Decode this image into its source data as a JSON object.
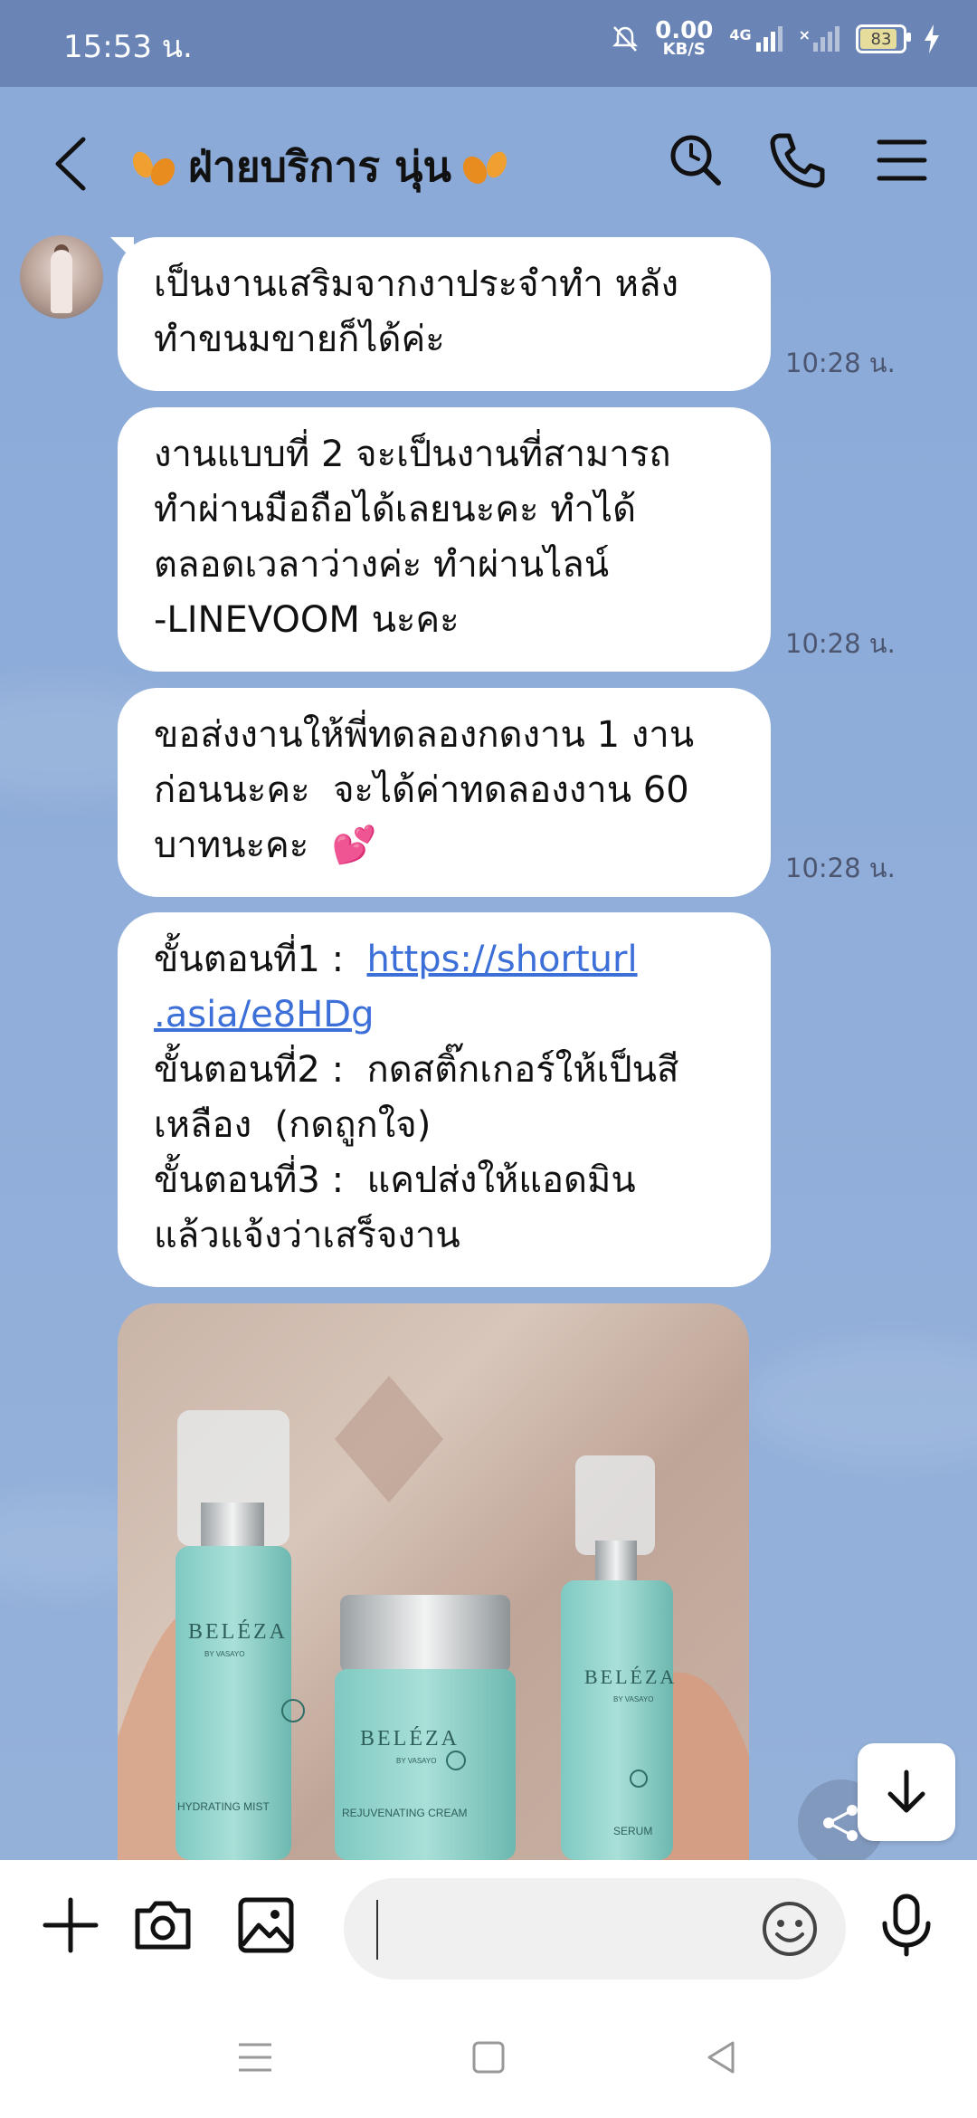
{
  "status_bar": {
    "time": "15:53 น.",
    "net_speed_value": "0.00",
    "net_speed_unit": "KB/S",
    "network": "4G",
    "battery": "83"
  },
  "header": {
    "title": "ฝ่ายบริการ นุ่น",
    "icons": [
      "back-icon",
      "search-icon",
      "phone-icon",
      "menu-icon"
    ]
  },
  "messages": [
    {
      "text": "เป็นงานเสริมจากงาประจำทำ หลัง\nทำขนมขายก็ได้ค่ะ",
      "time": "10:28 น."
    },
    {
      "text": "งานแบบที่ 2 จะเป็นงานที่สามารถ\nทำผ่านมือถือได้เลยนะคะ ทำได้\nตลอดเวลาว่างค่ะ ทำผ่านไลน์\n-LINEVOOM นะคะ",
      "time": "10:28 น."
    },
    {
      "text": "ขอส่งงานให้พี่ทดลองกดงาน 1 งาน\nก่อนนะคะ  จะได้ค่าทดลองงาน 60\nบาทนะคะ  ",
      "emoji": "💕",
      "time": "10:28 น."
    },
    {
      "step1_label": "ขั้นตอนที่1 :  ",
      "step1_link_a": "https://shorturl",
      "step1_link_b": ".asia/e8HDg",
      "step2": "ขั้นตอนที่2 :  กดสติ๊กเกอร์ให้เป็นสี\nเหลือง  (กดถูกใจ)",
      "step3": "ขั้นตอนที่3 :  แคปส่งให้แอดมิน\nแล้วแจ้งว่าเสร็จงาน"
    }
  ],
  "photo": {
    "brand": "BELÉZA",
    "sub_brand": "BY VASAYO",
    "products": [
      "HYDRATING MIST",
      "REJUVENATING CREAM",
      "SERUM"
    ]
  },
  "input": {
    "placeholder": ""
  },
  "colors": {
    "chat_bg": "#8eaad6",
    "status_bar": "#6a85b5",
    "link": "#3c6fd8",
    "bubble": "#ffffff"
  }
}
